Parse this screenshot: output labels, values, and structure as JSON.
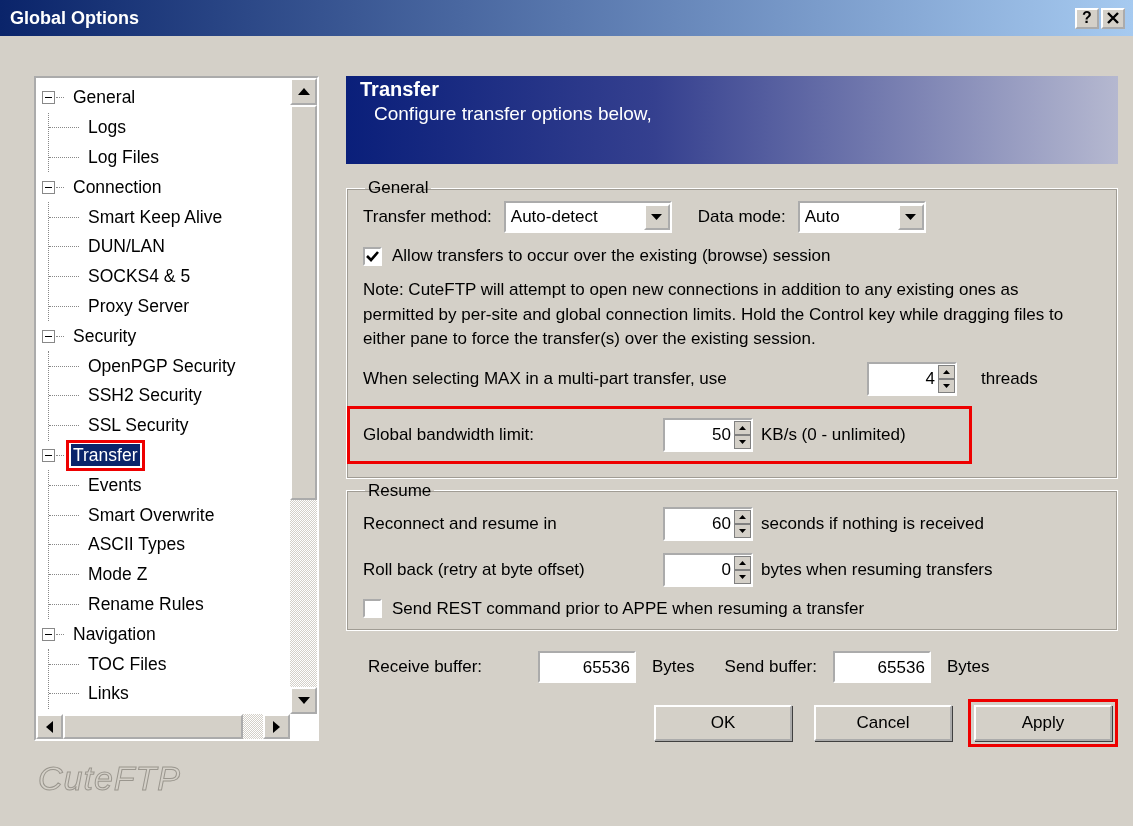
{
  "window": {
    "title": "Global Options",
    "help_button": "?"
  },
  "tree": {
    "items": [
      {
        "label": "General",
        "expanded": true,
        "selected": false,
        "highlighted": false,
        "children": [
          {
            "label": "Logs",
            "selected": false,
            "highlighted": false
          },
          {
            "label": "Log Files",
            "selected": false,
            "highlighted": false
          }
        ]
      },
      {
        "label": "Connection",
        "expanded": true,
        "selected": false,
        "highlighted": false,
        "children": [
          {
            "label": "Smart Keep Alive",
            "selected": false,
            "highlighted": false
          },
          {
            "label": "DUN/LAN",
            "selected": false,
            "highlighted": false
          },
          {
            "label": "SOCKS4 & 5",
            "selected": false,
            "highlighted": false
          },
          {
            "label": "Proxy Server",
            "selected": false,
            "highlighted": false
          }
        ]
      },
      {
        "label": "Security",
        "expanded": true,
        "selected": false,
        "highlighted": false,
        "children": [
          {
            "label": "OpenPGP Security",
            "selected": false,
            "highlighted": false
          },
          {
            "label": "SSH2 Security",
            "selected": false,
            "highlighted": false
          },
          {
            "label": "SSL Security",
            "selected": false,
            "highlighted": false
          }
        ]
      },
      {
        "label": "Transfer",
        "expanded": true,
        "selected": true,
        "highlighted": true,
        "children": [
          {
            "label": "Events",
            "selected": false,
            "highlighted": false
          },
          {
            "label": "Smart Overwrite",
            "selected": false,
            "highlighted": false
          },
          {
            "label": "ASCII Types",
            "selected": false,
            "highlighted": false
          },
          {
            "label": "Mode Z",
            "selected": false,
            "highlighted": false
          },
          {
            "label": "Rename Rules",
            "selected": false,
            "highlighted": false
          }
        ]
      },
      {
        "label": "Navigation",
        "expanded": true,
        "selected": false,
        "highlighted": false,
        "children": [
          {
            "label": "TOC Files",
            "selected": false,
            "highlighted": false
          },
          {
            "label": "Links",
            "selected": false,
            "highlighted": false
          }
        ]
      }
    ]
  },
  "logo": "CuteFTP",
  "header": {
    "title": "Transfer",
    "subtitle": "Configure transfer options below,"
  },
  "general": {
    "legend": "General",
    "transfer_method": {
      "label": "Transfer method:",
      "value": "Auto-detect"
    },
    "data_mode": {
      "label": "Data mode:",
      "value": "Auto"
    },
    "allow_checkbox": {
      "label": "Allow transfers to occur over the existing (browse) session",
      "checked": true
    },
    "note": "Note: CuteFTP will attempt to open new connections in addition to any existing ones as permitted by per-site and global connection limits. Hold the Control key while dragging files to either pane to force the transfer(s) over the existing session.",
    "max_threads": {
      "label": "When selecting MAX in a multi-part transfer, use",
      "value": "4",
      "unit": "threads",
      "highlighted": false
    },
    "bandwidth": {
      "label": "Global bandwidth limit:",
      "value": "50",
      "unit": "KB/s (0 - unlimited)",
      "highlighted": true
    }
  },
  "resume": {
    "legend": "Resume",
    "rows": [
      {
        "label": "Reconnect and resume in",
        "value": "60",
        "unit": "seconds if nothing is received"
      },
      {
        "label": "Roll back (retry at byte offset)",
        "value": "0",
        "unit": "bytes when resuming transfers"
      }
    ],
    "rest_checkbox": {
      "label": "Send REST command prior to APPE when resuming a transfer",
      "checked": false
    }
  },
  "buffers": [
    {
      "label": "Receive buffer:",
      "value": "65536",
      "unit": "Bytes"
    },
    {
      "label": "Send buffer:",
      "value": "65536",
      "unit": "Bytes"
    }
  ],
  "buttons": [
    {
      "label": "OK",
      "highlighted": false
    },
    {
      "label": "Cancel",
      "highlighted": false
    },
    {
      "label": "Apply",
      "highlighted": true
    }
  ]
}
